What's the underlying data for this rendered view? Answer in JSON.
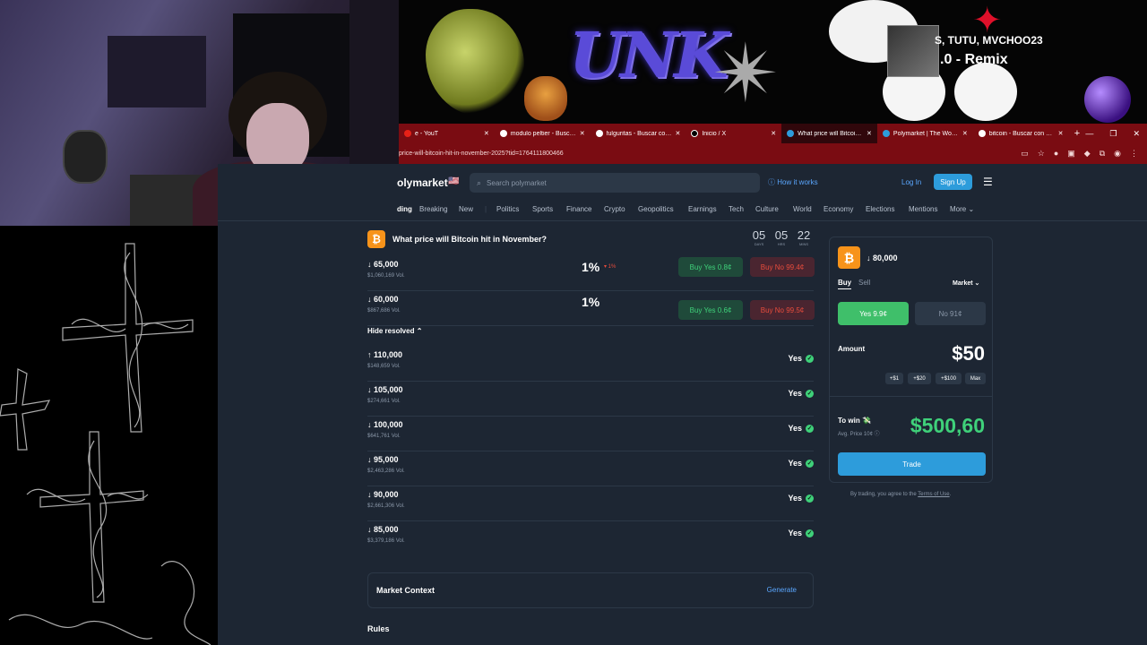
{
  "banner": {
    "artist": "S, TUTU, MVCHOO23",
    "title": ".0 - Remix",
    "graffiti": "UNK"
  },
  "browser": {
    "tabs": [
      {
        "label": "e - YouT",
        "favicon_color": "#e62117",
        "active": false
      },
      {
        "label": "modulo peltier - Buscar c",
        "favicon_color": "#ffffff",
        "active": false
      },
      {
        "label": "fulguritas - Buscar con G",
        "favicon_color": "#ffffff",
        "active": false
      },
      {
        "label": "Inicio / X",
        "favicon_color": "#000000",
        "active": false
      },
      {
        "label": "What price will Bitcoin hit",
        "favicon_color": "#2d9cdb",
        "active": true
      },
      {
        "label": "Polymarket | The World's",
        "favicon_color": "#2d9cdb",
        "active": false
      },
      {
        "label": "bitcoin - Buscar con Goo",
        "favicon_color": "#ffffff",
        "active": false
      }
    ],
    "url": "price-will-bitcoin-hit-in-november-2025?tid=1764111800466"
  },
  "nav": {
    "logo": "olymarket",
    "flag": "🇺🇸",
    "search_placeholder": "Search polymarket",
    "how_it_works": "How it works",
    "login": "Log In",
    "signup": "Sign Up"
  },
  "categories": [
    "ding",
    "Breaking",
    "New",
    "Politics",
    "Sports",
    "Finance",
    "Crypto",
    "Geopolitics",
    "Earnings",
    "Tech",
    "Culture",
    "World",
    "Economy",
    "Elections",
    "Mentions",
    "More"
  ],
  "market": {
    "title": "What price will Bitcoin hit in November?",
    "countdown": [
      {
        "value": "05",
        "unit": "DAYS"
      },
      {
        "value": "05",
        "unit": "HRS"
      },
      {
        "value": "22",
        "unit": "MINS"
      }
    ],
    "active_rows": [
      {
        "strike": "↓ 65,000",
        "vol": "$1,060,169 Vol.",
        "pct": "1%",
        "change": "▾ 1%",
        "buy_yes": "Buy Yes 0.8¢",
        "buy_no": "Buy No 99.4¢"
      },
      {
        "strike": "↓ 60,000",
        "vol": "$867,686 Vol.",
        "pct": "1%",
        "change": "",
        "buy_yes": "Buy Yes 0.6¢",
        "buy_no": "Buy No 99.5¢"
      }
    ],
    "hide_resolved": "Hide resolved ⌃",
    "resolved_rows": [
      {
        "strike": "↑ 110,000",
        "vol": "$148,659 Vol.",
        "result": "Yes"
      },
      {
        "strike": "↓ 105,000",
        "vol": "$274,661 Vol.",
        "result": "Yes"
      },
      {
        "strike": "↓ 100,000",
        "vol": "$641,761 Vol.",
        "result": "Yes"
      },
      {
        "strike": "↓ 95,000",
        "vol": "$2,463,286 Vol.",
        "result": "Yes"
      },
      {
        "strike": "↓ 90,000",
        "vol": "$2,661,306 Vol.",
        "result": "Yes"
      },
      {
        "strike": "↓ 85,000",
        "vol": "$3,379,186 Vol.",
        "result": "Yes"
      }
    ],
    "context_title": "Market Context",
    "generate": "Generate",
    "rules": "Rules"
  },
  "trade": {
    "strike": "↓ 80,000",
    "buy": "Buy",
    "sell": "Sell",
    "mode": "Market ⌄",
    "yes_btn": "Yes 9.9¢",
    "no_btn": "No 91¢",
    "amount_label": "Amount",
    "amount": "$50",
    "quick": [
      "+$1",
      "+$20",
      "+$100",
      "Max"
    ],
    "to_win_label": "To win 💸",
    "avg_price": "Avg. Price 10¢ ⓘ",
    "to_win": "$500,60",
    "trade_btn": "Trade",
    "terms_prefix": "By trading, you agree to the ",
    "terms_link": "Terms of Use",
    "terms_suffix": "."
  },
  "colors": {
    "page_bg": "#1d2633",
    "accent_blue": "#2d9cdb",
    "green": "#3fd17a",
    "red": "#e74c3c",
    "bitcoin": "#f7931a",
    "browser_red": "#7a0c12"
  }
}
